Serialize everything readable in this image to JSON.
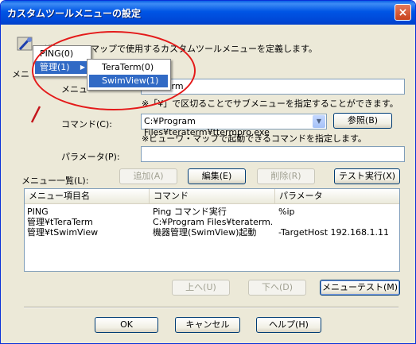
{
  "window": {
    "title": "カスタムツールメニューの設定",
    "close_symbol": "×"
  },
  "description": "ビューワ・マップで使用するカスタムツールメニューを定義します。",
  "desc_prefix_visible": "ビ",
  "group_label_partial": "メニ",
  "menu_name": {
    "label_partial": "メニュ",
    "value": "TeraTerm",
    "hint": "※「¥」で区切ることでサブメニューを指定することができます。"
  },
  "command": {
    "label": "コマンド(C):",
    "value": "C:¥Program Files¥teraterm¥ttermpro.exe",
    "browse_button": "参照(B)",
    "hint": "※ビューワ・マップで起動できるコマンドを指定します。"
  },
  "parameter": {
    "label": "パラメータ(P):",
    "value": ""
  },
  "menu_list": {
    "label": "メニュー一覧(L):",
    "buttons": {
      "add": "追加(A)",
      "edit": "編集(E)",
      "delete": "削除(R)",
      "test_run": "テスト実行(X)"
    },
    "columns": [
      "メニュー項目名",
      "コマンド",
      "パラメータ"
    ],
    "rows": [
      [
        "PING",
        "Ping コマンド実行",
        "%ip"
      ],
      [
        "管理¥tTeraTerm",
        "C:¥Program Files¥teraterm...",
        ""
      ],
      [
        "管理¥tSwimView",
        "機器管理(SwimView)起動",
        "-TargetHost 192.168.1.11"
      ]
    ]
  },
  "order_buttons": {
    "up": "上へ(U)",
    "down": "下へ(D)",
    "menu_test": "メニューテスト(M)"
  },
  "footer": {
    "ok": "OK",
    "cancel": "キャンセル",
    "help": "ヘルプ(H)"
  },
  "context_menu": {
    "items": [
      "PING(0)",
      "管理(1)"
    ],
    "submenu_arrow": "▶",
    "submenu": [
      "TeraTerm(0)",
      "SwimView(1)"
    ],
    "selected_submenu": "SwimView(1)"
  },
  "colors": {
    "titlebar": "#0055e5",
    "highlight": "#316ac5",
    "annotation": "#e41a1a",
    "dialog_bg": "#ece9d8"
  }
}
